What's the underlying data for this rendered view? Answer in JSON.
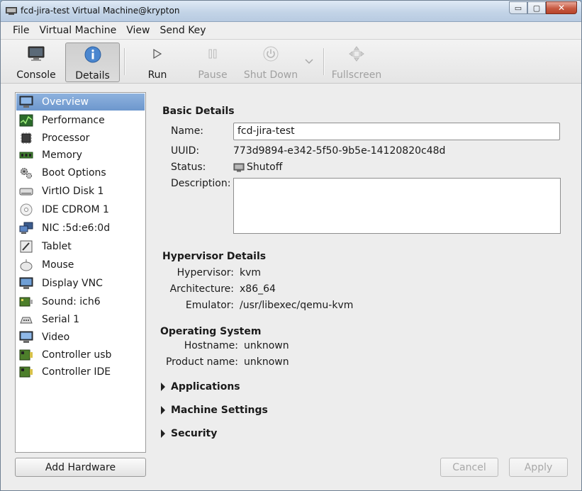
{
  "window": {
    "title": "fcd-jira-test Virtual Machine@krypton"
  },
  "window_controls": {
    "minimize": "▭",
    "maximize": "▢",
    "close": "✕"
  },
  "menu": [
    {
      "label": "File"
    },
    {
      "label": "Virtual Machine"
    },
    {
      "label": "View"
    },
    {
      "label": "Send Key"
    }
  ],
  "toolbar": {
    "console": "Console",
    "details": "Details",
    "run": "Run",
    "pause": "Pause",
    "shutdown": "Shut Down",
    "fullscreen": "Fullscreen"
  },
  "sidebar": {
    "items": [
      {
        "label": "Overview",
        "icon": "monitor-icon"
      },
      {
        "label": "Performance",
        "icon": "performance-icon"
      },
      {
        "label": "Processor",
        "icon": "chip-icon"
      },
      {
        "label": "Memory",
        "icon": "memory-icon"
      },
      {
        "label": "Boot Options",
        "icon": "gears-icon"
      },
      {
        "label": "VirtIO Disk 1",
        "icon": "disk-icon"
      },
      {
        "label": "IDE CDROM 1",
        "icon": "cdrom-icon"
      },
      {
        "label": "NIC :5d:e6:0d",
        "icon": "network-icon"
      },
      {
        "label": "Tablet",
        "icon": "tablet-icon"
      },
      {
        "label": "Mouse",
        "icon": "mouse-icon"
      },
      {
        "label": "Display VNC",
        "icon": "display-icon"
      },
      {
        "label": "Sound: ich6",
        "icon": "sound-icon"
      },
      {
        "label": "Serial 1",
        "icon": "serial-icon"
      },
      {
        "label": "Video",
        "icon": "video-icon"
      },
      {
        "label": "Controller usb",
        "icon": "controller-icon"
      },
      {
        "label": "Controller IDE",
        "icon": "controller-icon"
      }
    ],
    "add_hardware": "Add Hardware"
  },
  "basic": {
    "title": "Basic Details",
    "name_label": "Name:",
    "name_value": "fcd-jira-test",
    "uuid_label": "UUID:",
    "uuid_value": "773d9894-e342-5f50-9b5e-14120820c48d",
    "status_label": "Status:",
    "status_value": "Shutoff",
    "description_label": "Description:"
  },
  "hypervisor": {
    "title": "Hypervisor Details",
    "hypervisor_label": "Hypervisor:",
    "hypervisor_value": "kvm",
    "arch_label": "Architecture:",
    "arch_value": "x86_64",
    "emulator_label": "Emulator:",
    "emulator_value": "/usr/libexec/qemu-kvm"
  },
  "os": {
    "title": "Operating System",
    "hostname_label": "Hostname:",
    "hostname_value": "unknown",
    "product_label": "Product name:",
    "product_value": "unknown"
  },
  "expanders": {
    "applications": "Applications",
    "machine_settings": "Machine Settings",
    "security": "Security"
  },
  "footer": {
    "cancel": "Cancel",
    "apply": "Apply"
  }
}
